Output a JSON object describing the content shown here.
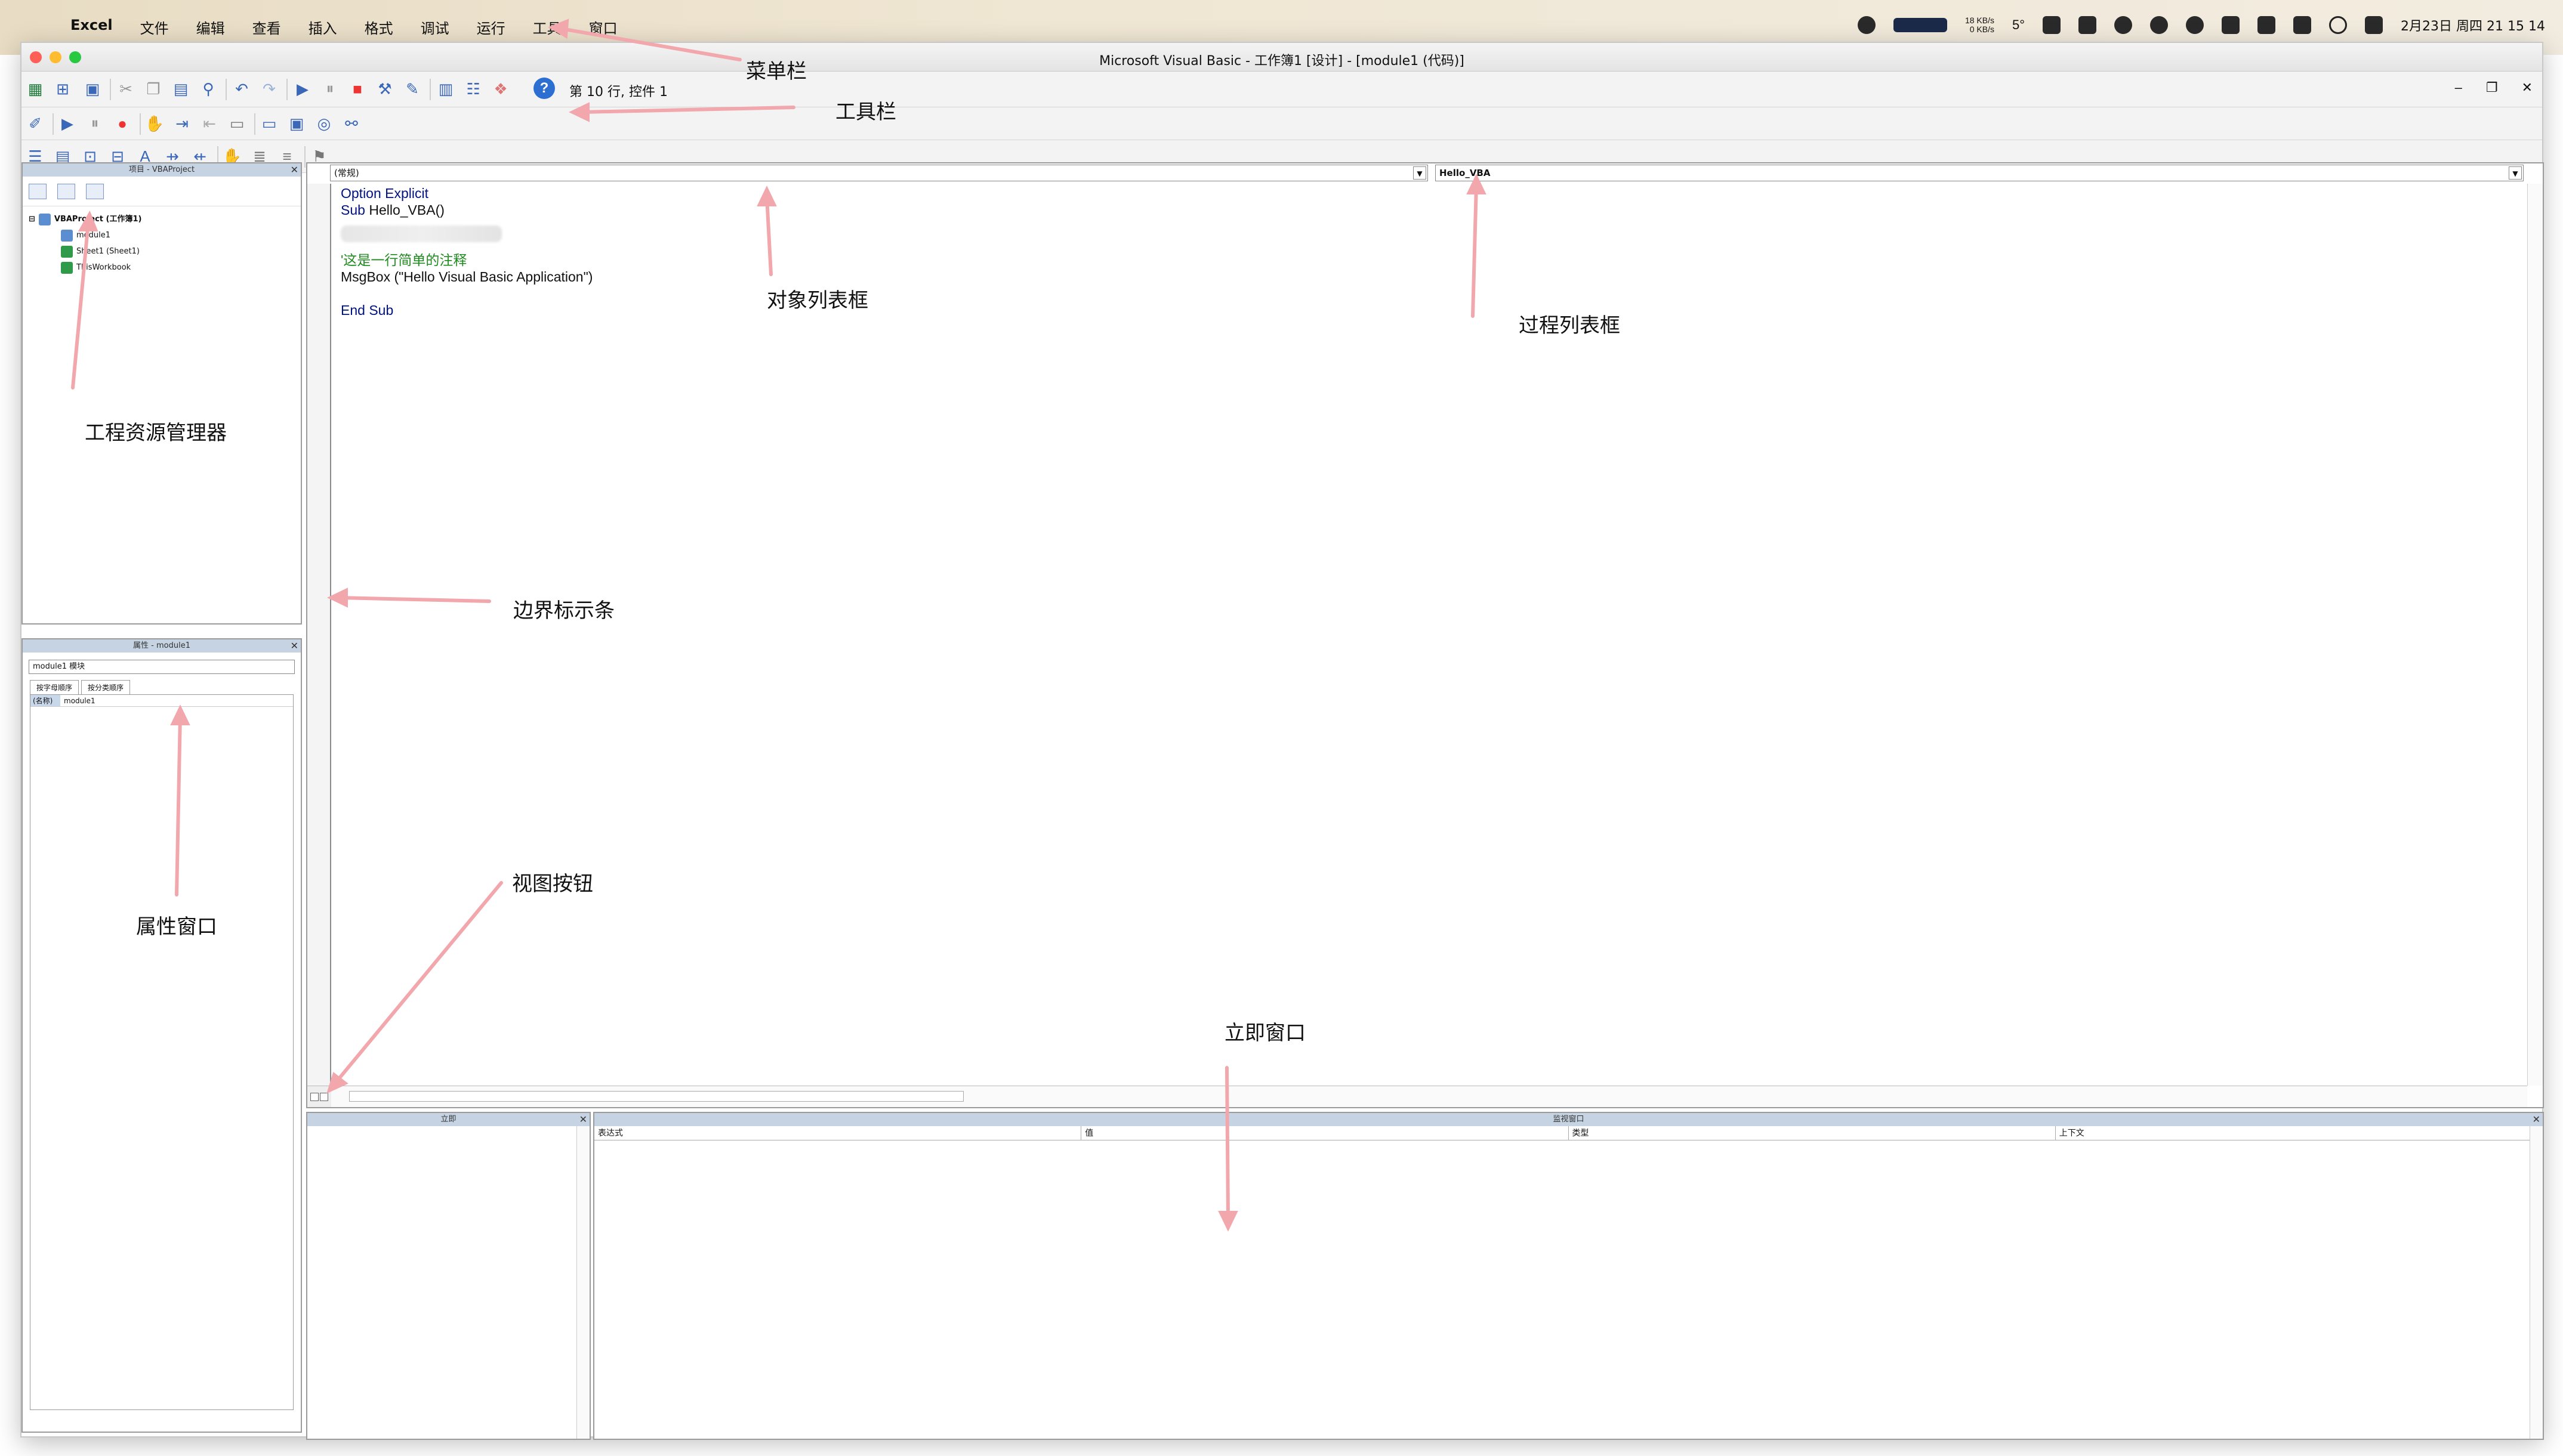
{
  "menubar": {
    "items": [
      "Excel",
      "文件",
      "编辑",
      "查看",
      "插入",
      "格式",
      "调试",
      "运行",
      "工具",
      "窗口"
    ],
    "net_up": "18 KB/s",
    "net_down": "0 KB/s",
    "temp": "5°",
    "clock": "2月23日 周四 21 15 14"
  },
  "window": {
    "title": "Microsoft Visual Basic - 工作簿1 [设计] - [module1 (代码)]",
    "status_text": "第 10 行, 控件 1"
  },
  "project": {
    "header": "项目 - VBAProject",
    "tree": {
      "root": "VBAProject (工作簿1)",
      "children": [
        "module1",
        "Sheet1 (Sheet1)",
        "ThisWorkbook"
      ]
    }
  },
  "properties": {
    "header": "属性 - module1",
    "object": "module1 模块",
    "tabs": [
      "按字母顺序",
      "按分类顺序"
    ],
    "rows": [
      {
        "key": "(名称)",
        "value": "module1"
      }
    ]
  },
  "code": {
    "object_combo": "(常规)",
    "procedure_combo": "Hello_VBA",
    "lines": [
      {
        "t": "Option Explicit",
        "c": "kw"
      },
      {
        "t": "Sub Hello_VBA()",
        "c": "mix"
      },
      {
        "t": "",
        "c": "blur"
      },
      {
        "t": "'这是一行简单的注释",
        "c": "cm"
      },
      {
        "t": "MsgBox (\"Hello Visual Basic Application\")",
        "c": ""
      },
      {
        "t": "",
        "c": ""
      },
      {
        "t": "End Sub",
        "c": "kw"
      }
    ]
  },
  "immediate": {
    "header": "立即"
  },
  "watch": {
    "header": "监视窗口",
    "columns": [
      "表达式",
      "值",
      "类型",
      "上下文"
    ]
  },
  "annotations": {
    "menubar": "菜单栏",
    "toolbar": "工具栏",
    "object_list": "对象列表框",
    "procedure_list": "过程列表框",
    "project_explorer": "工程资源管理器",
    "margin_bar": "边界标示条",
    "view_buttons": "视图按钮",
    "properties_window": "属性窗口",
    "immediate_window": "立即窗口"
  },
  "colors": {
    "keyword": "#00137f",
    "comment": "#1f8a1f",
    "panel_header": "#c6d3e3",
    "annotation_arrow": "#f2a7ac"
  }
}
